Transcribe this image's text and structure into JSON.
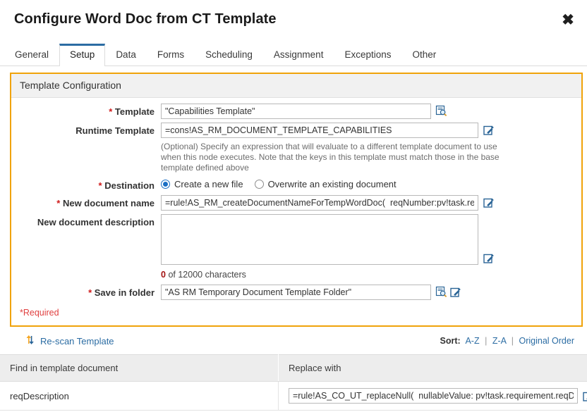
{
  "dialog": {
    "title": "Configure Word Doc from CT Template",
    "close_label": "✖"
  },
  "tabs": [
    {
      "label": "General",
      "active": false
    },
    {
      "label": "Setup",
      "active": true
    },
    {
      "label": "Data",
      "active": false
    },
    {
      "label": "Forms",
      "active": false
    },
    {
      "label": "Scheduling",
      "active": false
    },
    {
      "label": "Assignment",
      "active": false
    },
    {
      "label": "Exceptions",
      "active": false
    },
    {
      "label": "Other",
      "active": false
    }
  ],
  "panel": {
    "header": "Template Configuration",
    "accent_color": "#f0a30a",
    "required_note": "*Required",
    "fields": {
      "template": {
        "label": "Template",
        "required_marker": "*",
        "value": "\"Capabilities Template\"",
        "placeholder": "",
        "browse_icon": "document-search-icon"
      },
      "runtime_template": {
        "label": "Runtime Template",
        "value": "=cons!AS_RM_DOCUMENT_TEMPLATE_CAPABILITIES",
        "placeholder": "",
        "edit_icon": "edit-expression-icon",
        "help": "(Optional) Specify an expression that will evaluate to a different template document to use when this node executes. Note that the keys in this template must match those in the base template defined above"
      },
      "destination": {
        "label": "Destination",
        "required_marker": "*",
        "options": [
          {
            "label": "Create a new file",
            "selected": true
          },
          {
            "label": "Overwrite an existing document",
            "selected": false
          }
        ]
      },
      "new_document_name": {
        "label": "New document name",
        "required_marker": "*",
        "value": "=rule!AS_RM_createDocumentNameForTempWordDoc(  reqNumber:pv!task.requireme",
        "placeholder": "",
        "edit_icon": "edit-expression-icon"
      },
      "new_document_description": {
        "label": "New document description",
        "value": "",
        "placeholder": "",
        "edit_icon": "edit-expression-icon",
        "char_count_used": "0",
        "char_count_text": "of 12000 characters"
      },
      "save_in_folder": {
        "label": "Save in folder",
        "required_marker": "*",
        "value": "\"AS RM Temporary Document Template Folder\"",
        "placeholder": "",
        "browse_icon": "document-search-icon",
        "edit_icon": "edit-expression-icon"
      }
    }
  },
  "rescan": {
    "label": "Re-scan Template",
    "icon": "refresh-arrows-icon"
  },
  "sort": {
    "label": "Sort:",
    "options": [
      "A-Z",
      "Z-A",
      "Original Order"
    ],
    "separator": "|"
  },
  "grid": {
    "columns": [
      "Find in template document",
      "Replace with"
    ],
    "rows": [
      {
        "find": "reqDescription",
        "replace": "=rule!AS_CO_UT_replaceNull(  nullableValue: pv!task.requirement.reqDescription",
        "edit_icon": "edit-expression-icon"
      }
    ]
  }
}
